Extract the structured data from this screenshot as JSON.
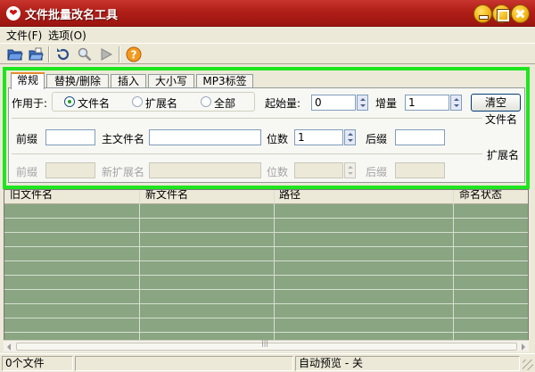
{
  "window": {
    "title": "文件批量改名工具",
    "icon": "heart-icon",
    "accent_color": "#b01e18",
    "highlight_color": "#1ee61e"
  },
  "menu": {
    "file": "文件(F)",
    "options": "选项(O)"
  },
  "toolbar": {
    "icons": [
      "open-folder-icon",
      "open-files-icon",
      "undo-icon",
      "search-icon",
      "play-icon",
      "help-icon"
    ]
  },
  "tabs": [
    {
      "label": "常规",
      "active": true
    },
    {
      "label": "替换/删除",
      "active": false
    },
    {
      "label": "插入",
      "active": false
    },
    {
      "label": "大小写",
      "active": false
    },
    {
      "label": "MP3标签",
      "active": false
    }
  ],
  "general": {
    "apply_to_label": "作用于:",
    "radio_filename": "文件名",
    "radio_extension": "扩展名",
    "radio_all": "全部",
    "selected": "文件名",
    "start_label": "起始量:",
    "start_value": "0",
    "increment_label": "增量",
    "increment_value": "1",
    "clear_button": "清空",
    "filename_section": "文件名",
    "extension_section": "扩展名",
    "prefix_label": "前缀",
    "prefix_value": "",
    "main_name_label": "主文件名",
    "main_name_value": "",
    "digits_label": "位数",
    "digits_value": "1",
    "suffix_label": "后缀",
    "suffix_value": "",
    "ext_prefix_label": "前缀",
    "new_ext_label": "新扩展名",
    "ext_digits_label": "位数",
    "ext_suffix_label": "后缀"
  },
  "grid": {
    "columns": [
      "旧文件名",
      "新文件名",
      "路径",
      "命名状态"
    ],
    "rows": []
  },
  "status": {
    "file_count": "0个文件",
    "middle": "",
    "preview": "自动预览 - 关"
  }
}
